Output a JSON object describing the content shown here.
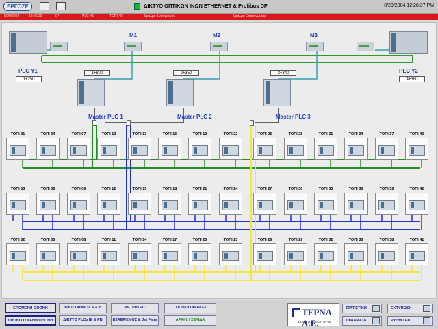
{
  "header": {
    "logo": "ΕΡΓΟΣΕ",
    "title": "ΔΙΚΤΥΟ ΟΠΤΙΚΩΝ ΙΝΩΝ ETHERNET & Profibus DP",
    "datetime": "8/29/2004 12:26:37 PM"
  },
  "alarm": {
    "cells": [
      "8/29/2004",
      "12:26:20",
      "ΣΡ",
      "PLC Y1",
      "ΤΟΠΙ 40",
      "Σφάλμα Συναγερμού",
      "Σφάλμα Επικοινωνίας"
    ]
  },
  "network": {
    "switches": [
      "M1",
      "M2",
      "M3"
    ],
    "plc_y1": {
      "label": "PLC Y1",
      "value": "1+250"
    },
    "plc_y2": {
      "label": "PLC Y2",
      "value": "4+380"
    },
    "masters": [
      {
        "label": "Master PLC 1",
        "value": "1+800"
      },
      {
        "label": "Master PLC 2",
        "value": "2+350"
      },
      {
        "label": "Master PLC 3",
        "value": "3+340"
      }
    ],
    "row1": [
      "ΤΟΠΙ 01",
      "ΤΟΠΙ 04",
      "ΤΟΠΙ 07",
      "ΤΟΠΙ 10",
      "ΤΟΠΙ 13",
      "ΤΟΠΙ 16",
      "ΤΟΠΙ 19",
      "ΤΟΠΙ 22",
      "ΤΟΠΙ 25",
      "ΤΟΠΙ 28",
      "ΤΟΠΙ 31",
      "ΤΟΠΙ 34",
      "ΤΟΠΙ 37",
      "ΤΟΠΙ 40"
    ],
    "row2": [
      "ΤΟΠΙ 03",
      "ΤΟΠΙ 06",
      "ΤΟΠΙ 09",
      "ΤΟΠΙ 12",
      "ΤΟΠΙ 15",
      "ΤΟΠΙ 18",
      "ΤΟΠΙ 21",
      "ΤΟΠΙ 24",
      "ΤΟΠΙ 27",
      "ΤΟΠΙ 30",
      "ΤΟΠΙ 33",
      "ΤΟΠΙ 36",
      "ΤΟΠΙ 39",
      "ΤΟΠΙ 42"
    ],
    "row3": [
      "ΤΟΠΙ 02",
      "ΤΟΠΙ 05",
      "ΤΟΠΙ 08",
      "ΤΟΠΙ 11",
      "ΤΟΠΙ 14",
      "ΤΟΠΙ 17",
      "ΤΟΠΙ 20",
      "ΤΟΠΙ 23",
      "ΤΟΠΙ 26",
      "ΤΟΠΙ 29",
      "ΤΟΠΙ 32",
      "ΤΟΠΙ 35",
      "ΤΟΠΙ 38",
      "ΤΟΠΙ 41"
    ],
    "colors": {
      "ethernet": "#2e9a2e",
      "profibus1": "#2a8a2a",
      "profibus2": "#2330c8",
      "profibus3": "#f2e63a",
      "link": "#3aa0b0"
    }
  },
  "nav": {
    "next_screen": "ΕΠΟΜΕΝΗ ΟΘΟΝΗ",
    "prev_screen": "ΠΡΟΗΓΟΥΜΕΝΗ ΟΘΟΝΗ",
    "substation": "ΥΠΟΣΤΑΘΜΟΣ Α & Β",
    "plc_network": "ΔΙΚΤΥΟ PLCs IE & PB",
    "measurements": "ΜΕΤΡΗΣΕΙΣ",
    "ventilation": "ΕΞΑΕΡΙΣΜΟΣ & Jet Fans",
    "local_panels": "ΤΟΠΙΚΟΙ ΠΙΝΑΚΕΣ",
    "home": "ΑΡΧΙΚΗ ΣΕΛΙΔΑ",
    "brand_name": "ΤΕΡΝΑ Α.Ε.",
    "brand_sub": "ΕΤΑΙΡΕΙΑ ΟΜΙΛΟΥ ΤΕΡΝΑ",
    "statistics": "ΣΤΑΤΙΣΤΙΚΗ",
    "faults": "ΣΦΑΛΜΑΤΑ",
    "print": "ΕΚΤΥΠΩΣΗ",
    "settings": "ΡΥΘΜΙΣΕΙΣ"
  }
}
